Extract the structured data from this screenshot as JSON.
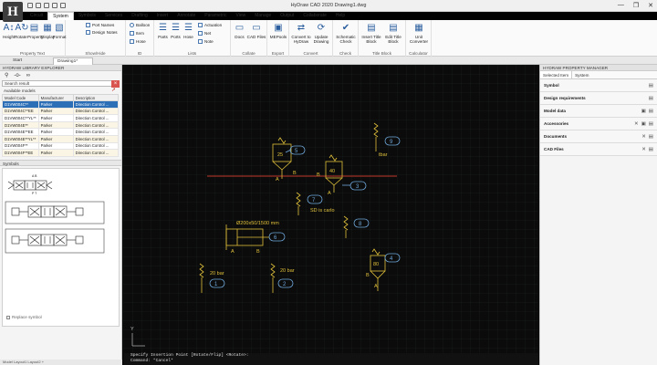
{
  "window": {
    "title": "HyDraw CAD 2020   Drawing1.dwg",
    "logo_text": "H",
    "controls": [
      "—",
      "❐",
      "✕"
    ]
  },
  "menu": {
    "tabs": [
      "Circuit",
      "System",
      "Symbols",
      "Services",
      "Drafting",
      "Insert",
      "Annotate",
      "Parametric",
      "View",
      "Manage",
      "Output",
      "Collaborate",
      "Help"
    ],
    "active": "System"
  },
  "ribbon": {
    "property_text": {
      "buttons": [
        "Height",
        "Rotate",
        "Property",
        "Display",
        "Format"
      ],
      "label": "Property Text"
    },
    "show_hide": {
      "items": [
        "Port Names",
        "Design Notes"
      ],
      "label": "Show/Hide"
    },
    "id": {
      "items": [
        "Balloon",
        "Item",
        "Hose"
      ],
      "label": "ID"
    },
    "lists": {
      "buttons": [
        "Parts",
        "Ports",
        "Hose"
      ],
      "items": [
        "Actuation",
        "Net",
        "Note"
      ],
      "label": "Lists"
    },
    "collate": {
      "buttons": [
        "Docs",
        "CAD Files"
      ],
      "label": "Collate"
    },
    "export": {
      "buttons": [
        "MEPools"
      ],
      "label": "Export"
    },
    "convert": {
      "buttons": [
        "Convert to HyDraw",
        "Update Drawing"
      ],
      "label": "Convert"
    },
    "check": {
      "buttons": [
        "Schematic Check"
      ],
      "label": "Check"
    },
    "title_block": {
      "buttons": [
        "Insert Title Block",
        "Edit Title Block"
      ],
      "label": "Title Block"
    },
    "calculator": {
      "buttons": [
        "Unit Converter"
      ],
      "label": "Calculator"
    }
  },
  "doc_tabs": [
    "Start",
    "Drawing1*"
  ],
  "left_panel": {
    "title": "HYDRAW LIBRARY EXPLORER",
    "search_placeholder": "Search result",
    "available_label": "Available models",
    "columns": [
      "Model Code",
      "Manufacturer",
      "Description"
    ],
    "rows": [
      [
        "D1VW004C**",
        "Parker",
        "Direction Control ..."
      ],
      [
        "D1VW004C**EE",
        "Parker",
        "Direction Control ..."
      ],
      [
        "D1VW004C**YL**",
        "Parker",
        "Direction Control ..."
      ],
      [
        "D1VW004E**",
        "Parker",
        "Direction Control ..."
      ],
      [
        "D1VW004E**EE",
        "Parker",
        "Direction Control ..."
      ],
      [
        "D1VW004E**YL**",
        "Parker",
        "Direction Control ..."
      ],
      [
        "D1VW004F**",
        "Parker",
        "Direction Control ..."
      ],
      [
        "D1VW004F**EE",
        "Parker",
        "Direction Control ..."
      ]
    ],
    "selected_row": 0,
    "symbols_label": "Symbols",
    "replace_label": "Replace symbol"
  },
  "canvas": {
    "balloons": [
      "1",
      "2",
      "3",
      "4",
      "5",
      "6",
      "7",
      "8",
      "9"
    ],
    "texts": {
      "bar20_a": "20 bar",
      "bar20_b": "20 bar",
      "tbar": "tbar",
      "cylinder": "Ø200x50/1500 mm",
      "sd": "SD is carlo",
      "v25": "25",
      "v40": "40",
      "v80": "80"
    },
    "port_a": "A",
    "port_b": "B",
    "ucs_y": "Y"
  },
  "command_line": {
    "line1": "Specify Insertion Point [Rotate/Flip] <Rotate>:",
    "line2": "Command: *Cancel*"
  },
  "status_bar": "Model  Layout1  Layout2  +",
  "right_panel": {
    "title": "HYDRAW PROPERTY MANAGER",
    "tabs": [
      "Selected Item",
      "System"
    ],
    "sections": [
      "Symbol",
      "Design requirements",
      "Model data",
      "Accessories",
      "Documents",
      "CAD Files"
    ]
  },
  "colors": {
    "canvas_bg": "#0b0b0b",
    "symbol_yellow": "#e0c03a",
    "balloon_blue": "#6fa8dc",
    "pressure_line": "#c0392b",
    "selection_blue": "#2c6fb7"
  }
}
